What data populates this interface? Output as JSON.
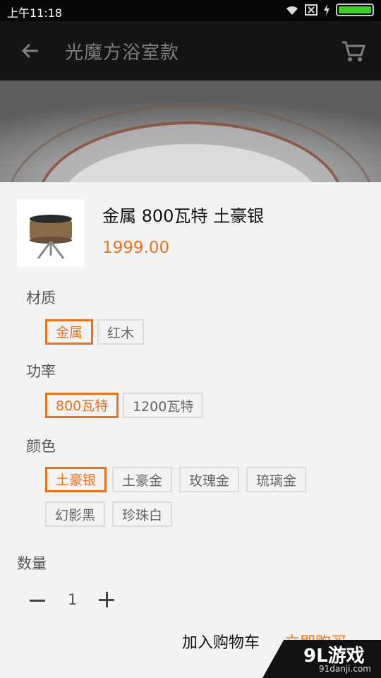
{
  "status": {
    "time": "上午11:18",
    "battery_level": 1.0
  },
  "appbar": {
    "title": "光魔方浴室款",
    "back_icon": "arrow-left-icon",
    "cart_icon": "shopping-cart-icon"
  },
  "product": {
    "name": "金属 800瓦特 土豪银",
    "price": "1999.00",
    "image": "round-wooden-speaker-on-tripod"
  },
  "sections": {
    "material": {
      "label": "材质",
      "options": [
        "金属",
        "红木"
      ],
      "selected": "金属"
    },
    "power": {
      "label": "功率",
      "options": [
        "800瓦特",
        "1200瓦特"
      ],
      "selected": "800瓦特"
    },
    "color": {
      "label": "颜色",
      "options": [
        "土豪银",
        "土豪金",
        "玫瑰金",
        "琉璃金",
        "幻影黑",
        "珍珠白"
      ],
      "selected": "土豪银"
    }
  },
  "quantity": {
    "label": "数量",
    "value": "1"
  },
  "actions": {
    "add_to_cart": "加入购物车",
    "buy_now": "立即购买"
  },
  "watermark": {
    "logo": "9L游戏",
    "url": "91danji.com"
  },
  "colors": {
    "accent": "#e8731c",
    "appbar": "#141414"
  }
}
